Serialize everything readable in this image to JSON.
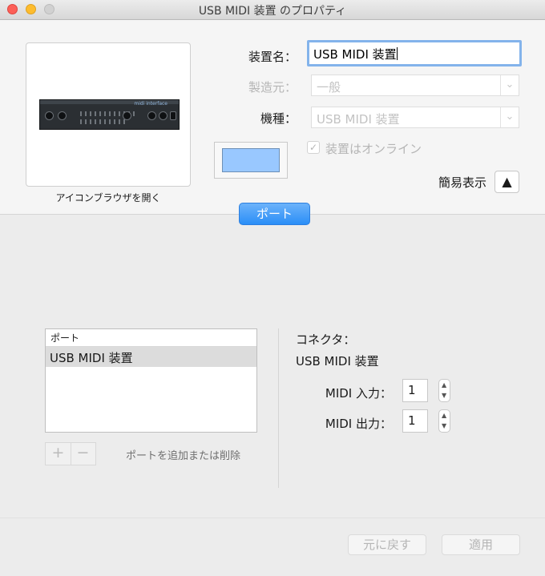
{
  "window": {
    "title": "USB MIDI 装置 のプロパティ"
  },
  "icon_panel": {
    "browser_label": "アイコンブラウザを開く",
    "device_brand": "midi interface"
  },
  "fields": {
    "device_name_label": "装置名：",
    "device_name_value": "USB MIDI 装置",
    "manufacturer_label": "製造元：",
    "manufacturer_value": "一般",
    "model_label": "機種：",
    "model_value": "USB MIDI 装置",
    "online_label": "装置はオンライン",
    "online_checked": true
  },
  "simple_display": {
    "label": "簡易表示",
    "arrow": "▲"
  },
  "tab": {
    "label": "ポート"
  },
  "ports": {
    "header": "ポート",
    "items": [
      "USB MIDI 装置"
    ]
  },
  "port_controls": {
    "plus": "+",
    "minus": "−",
    "add_remove_label": "ポートを追加または削除"
  },
  "connector": {
    "label": "コネクタ：",
    "value": "USB MIDI 装置",
    "midi_in_label": "MIDI 入力：",
    "midi_in_value": "1",
    "midi_out_label": "MIDI 出力：",
    "midi_out_value": "1"
  },
  "buttons": {
    "revert": "元に戻す",
    "apply": "適用"
  },
  "colors": {
    "swatch": "#99c8ff",
    "tab_blue": "#2a8ef7",
    "focus_ring": "#83b3eb"
  },
  "icons": {
    "checkbox_mark": "✓",
    "select_arrow": "⌄",
    "stepper_up": "▲",
    "stepper_down": "▼"
  }
}
